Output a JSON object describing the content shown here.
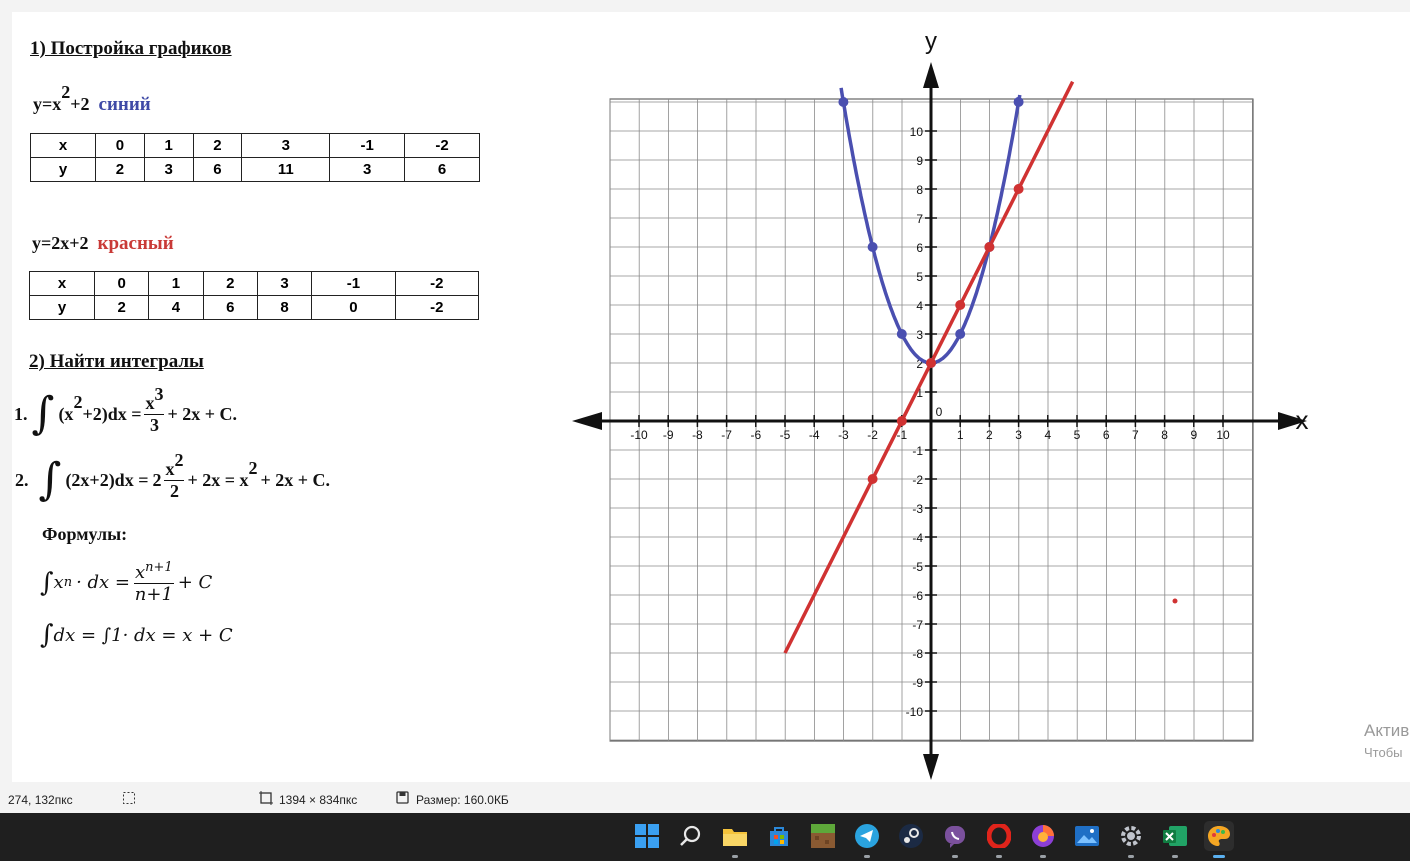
{
  "section1": {
    "title": "1) Постройка графиков"
  },
  "eq1": {
    "lhs": "y=x",
    "exp": "2",
    "rhs": "+2",
    "color_word": "синий",
    "color": "#3f4aa6"
  },
  "table1": {
    "rows": [
      {
        "label": "x",
        "cells": [
          "0",
          "1",
          "2",
          "3",
          "-1",
          "-2"
        ]
      },
      {
        "label": "y",
        "cells": [
          "2",
          "3",
          "6",
          "11",
          "3",
          "6"
        ]
      }
    ]
  },
  "eq2": {
    "text": "y=2x+2",
    "color_word": "красный",
    "color": "#c93a37"
  },
  "table2": {
    "rows": [
      {
        "label": "x",
        "cells": [
          "0",
          "1",
          "2",
          "3",
          "-1",
          "-2"
        ]
      },
      {
        "label": "y",
        "cells": [
          "2",
          "4",
          "6",
          "8",
          "0",
          "-2"
        ]
      }
    ]
  },
  "section2": {
    "title": "2) Найти интегралы"
  },
  "int1": {
    "num": "1.",
    "integrand": "(x",
    "exp": "2",
    "integrand_rest": "+2)dx =",
    "frac_num": "x",
    "frac_num_exp": "3",
    "frac_den": "3",
    "tail": "+ 2x + C."
  },
  "int2": {
    "num": "2.",
    "integrand": "(2x+2)dx =",
    "coef": "2",
    "frac_num": "x",
    "frac_num_exp": "2",
    "frac_den": "2",
    "middle": "+ 2x = x",
    "middle_exp": "2",
    "tail": "+ 2x + C."
  },
  "formulas": {
    "title": "Формулы:",
    "f1_lhs": "x",
    "f1_lhs_exp": "n",
    "f1_lhs_rest": "· dx =",
    "f1_num": "x",
    "f1_num_exp": "n+1",
    "f1_den": "n+1",
    "f1_tail": "+ C",
    "f2": "dx = ∫1· dx = x + C"
  },
  "graph": {
    "axis_x_label": "x",
    "axis_y_label": "y",
    "origin_label": "0",
    "x_ticks": [
      "-10",
      "-9",
      "-8",
      "-7",
      "-6",
      "-5",
      "-4",
      "-3",
      "-2",
      "-1",
      "1",
      "2",
      "3",
      "4",
      "5",
      "6",
      "7",
      "8",
      "9",
      "10"
    ],
    "y_ticks": [
      "10",
      "9",
      "8",
      "7",
      "6",
      "5",
      "4",
      "3",
      "2",
      "1",
      "-1",
      "-2",
      "-3",
      "-4",
      "-5",
      "-6",
      "-7",
      "-8",
      "-9",
      "-10"
    ],
    "blue_color": "#4a4fb0",
    "red_color": "#d03232",
    "blue_points": [
      [
        -3,
        11
      ],
      [
        -2,
        6
      ],
      [
        -1,
        3
      ],
      [
        0,
        2
      ],
      [
        1,
        3
      ],
      [
        2,
        6
      ],
      [
        3,
        11
      ]
    ],
    "red_points": [
      [
        -2,
        -2
      ],
      [
        -1,
        0
      ],
      [
        0,
        2
      ],
      [
        1,
        4
      ],
      [
        2,
        6
      ],
      [
        3,
        8
      ]
    ]
  },
  "watermark": {
    "line1": "Актив",
    "line2": "Чтобы"
  },
  "statusbar": {
    "coords": "274, 132пкс",
    "dimensions": "1394 × 834пкс",
    "size": "Размер: 160.0КБ"
  }
}
